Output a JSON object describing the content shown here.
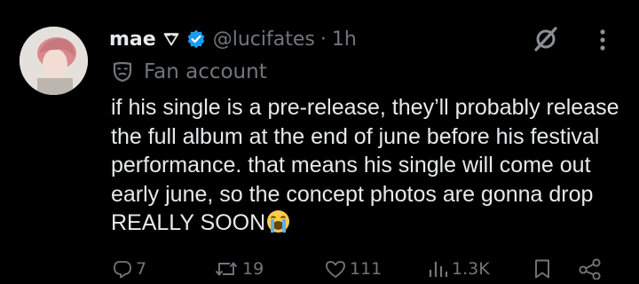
{
  "post": {
    "author_name": "mae",
    "handle": "@lucifates",
    "separator": "·",
    "time": "1h",
    "label": "Fan account",
    "text": "if his single is a pre-release, they’ll probably release the full album at the end of june before his festival performance. that means his single will come out early june, so the concept photos are gonna drop REALLY SOON",
    "emoji_icon": "loudly-crying-face"
  },
  "actions": {
    "replies": "7",
    "reposts": "19",
    "likes": "111",
    "views": "1.3K"
  },
  "colors": {
    "background": "#000000",
    "text": "#e7e9ea",
    "muted": "#71767b",
    "verified": "#1d9bf0"
  }
}
